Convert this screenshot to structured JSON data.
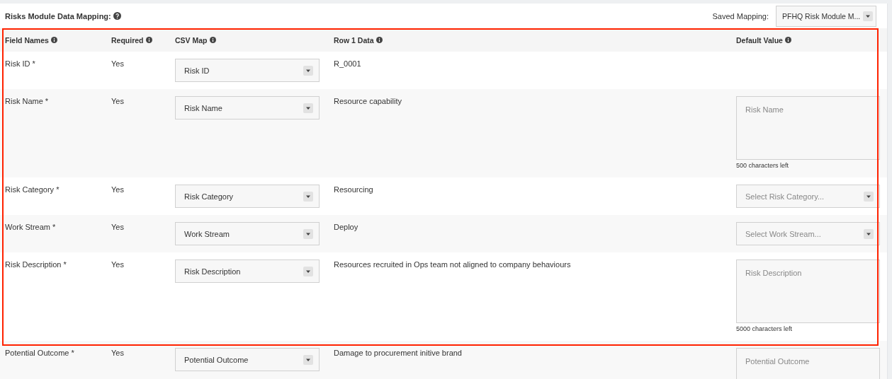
{
  "title": "Risks Module Data Mapping:",
  "saved_mapping": {
    "label": "Saved Mapping:",
    "value": "PFHQ Risk Module M..."
  },
  "table": {
    "columns": [
      "Field Names",
      "Required",
      "CSV Map",
      "Row 1 Data",
      "Default Value"
    ],
    "rows": [
      {
        "field": "Risk ID *",
        "required": "Yes",
        "csv_map": "Risk ID",
        "row1_data": "R_0001",
        "default": {
          "kind": "none"
        }
      },
      {
        "field": "Risk Name *",
        "required": "Yes",
        "csv_map": "Risk Name",
        "row1_data": "Resource capability",
        "default": {
          "kind": "textarea",
          "placeholder": "Risk Name",
          "counter": "500 characters left"
        }
      },
      {
        "field": "Risk Category *",
        "required": "Yes",
        "csv_map": "Risk Category",
        "row1_data": "Resourcing",
        "default": {
          "kind": "select",
          "placeholder": "Select Risk Category..."
        }
      },
      {
        "field": "Work Stream *",
        "required": "Yes",
        "csv_map": "Work Stream",
        "row1_data": "Deploy",
        "default": {
          "kind": "select",
          "placeholder": "Select Work Stream..."
        }
      },
      {
        "field": "Risk Description *",
        "required": "Yes",
        "csv_map": "Risk Description",
        "row1_data": "Resources recruited in Ops team not aligned to company behaviours",
        "default": {
          "kind": "textarea",
          "placeholder": "Risk Description",
          "counter": "5000 characters left"
        }
      },
      {
        "field": "Potential Outcome *",
        "required": "Yes",
        "csv_map": "Potential Outcome",
        "row1_data": "Damage to procurement initive brand",
        "default": {
          "kind": "textarea",
          "placeholder": "Potential Outcome"
        }
      }
    ]
  }
}
